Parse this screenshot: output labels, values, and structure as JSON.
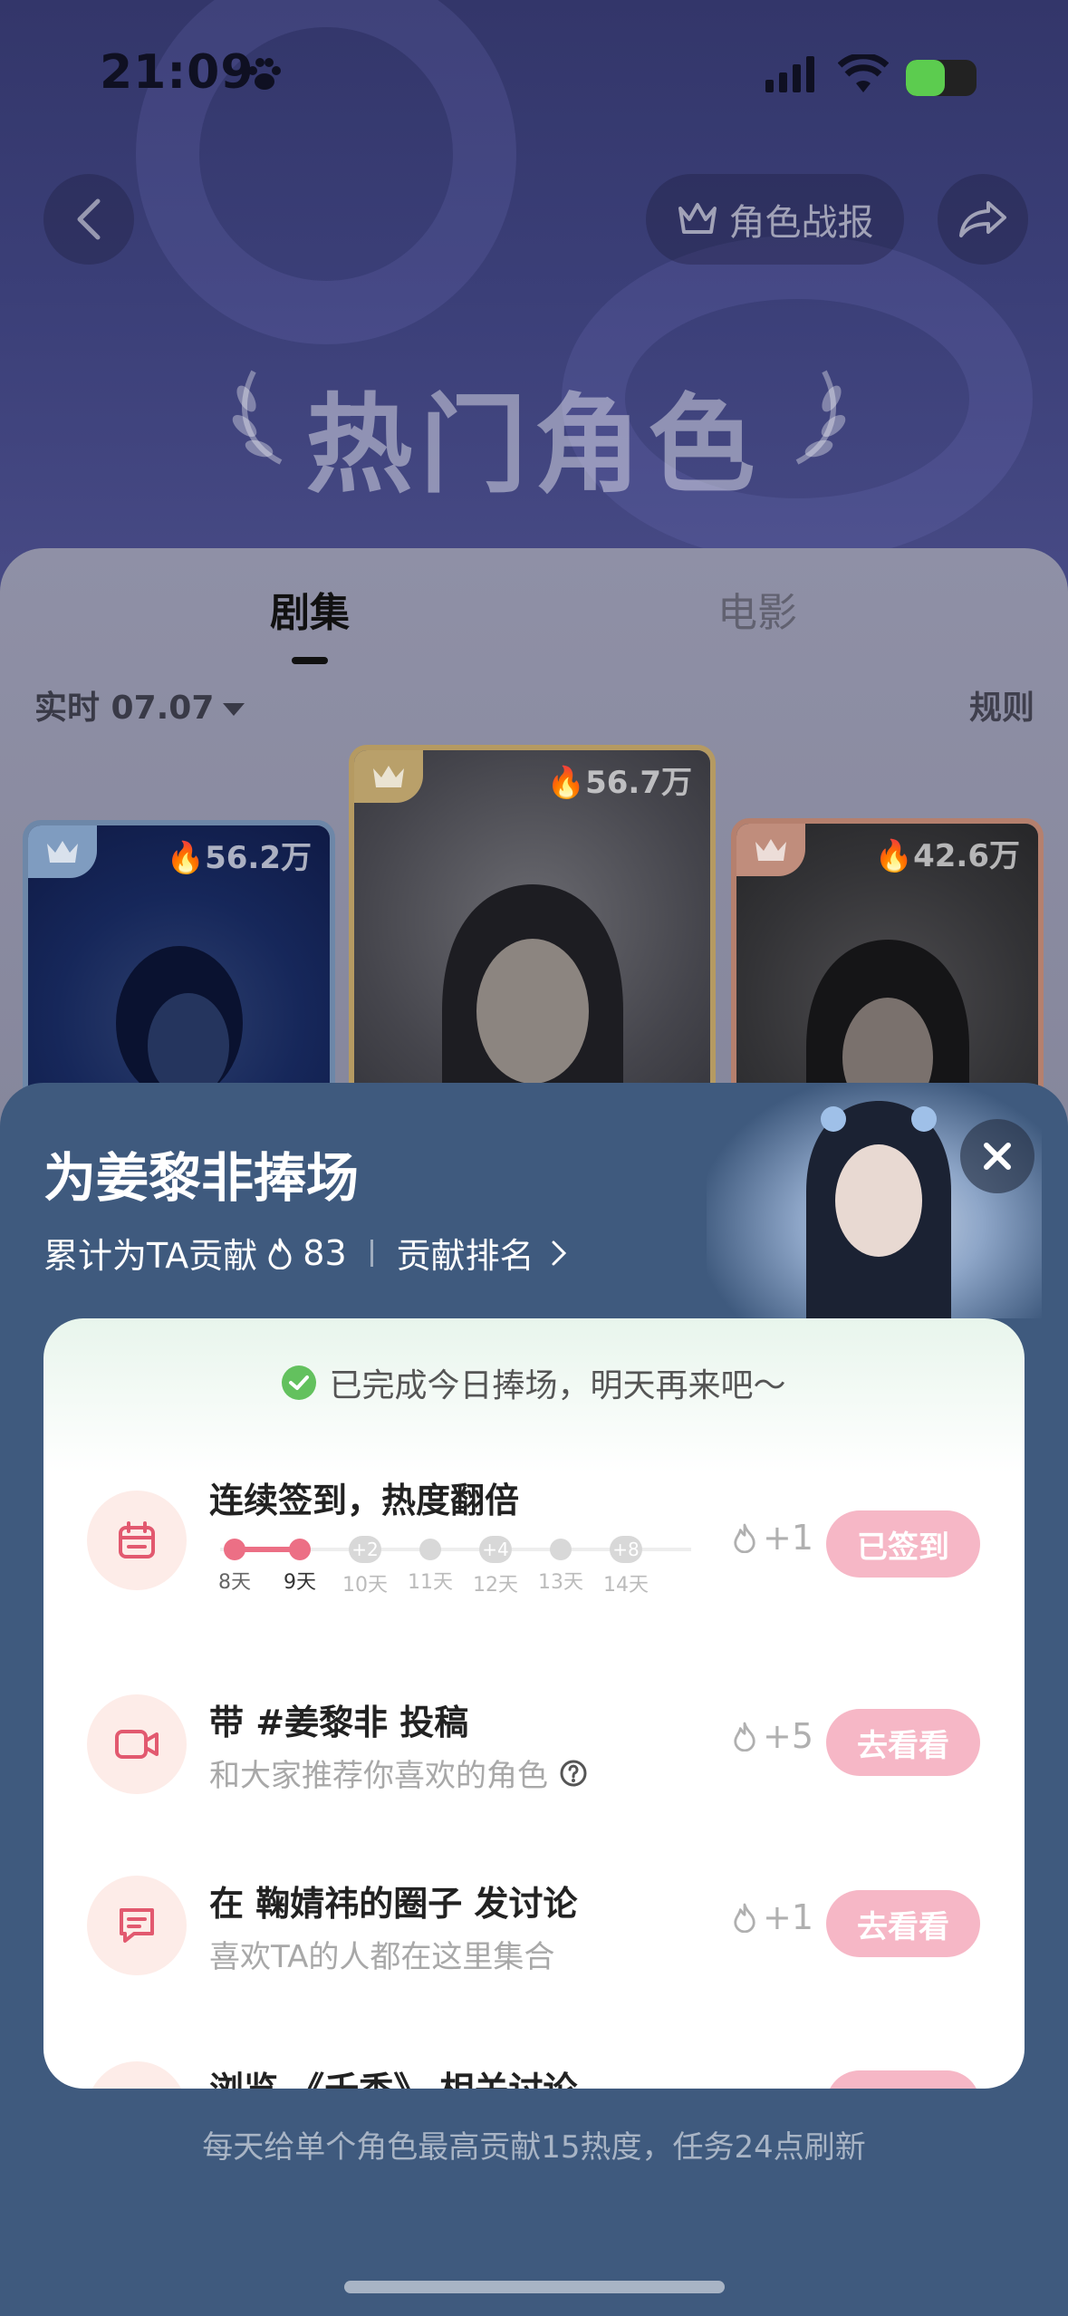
{
  "status_bar": {
    "time": "21:09"
  },
  "header": {
    "report_label": "角色战报"
  },
  "hero": {
    "title": "热门角色"
  },
  "tabs": [
    {
      "label": "剧集"
    },
    {
      "label": "电影"
    }
  ],
  "filter": {
    "label": "实时 07.07",
    "rules_label": "规则"
  },
  "cards": [
    {
      "heat": "56.2万"
    },
    {
      "heat": "56.7万"
    },
    {
      "heat": "42.6万"
    }
  ],
  "sheet": {
    "title": "为姜黎非捧场",
    "contribution_prefix": "累计为TA贡献",
    "contribution_value": "83",
    "ranking_label": "贡献排名",
    "done_tip": "已完成今日捧场，明天再来吧～",
    "tasks": [
      {
        "title": "连续签到，热度翻倍",
        "reward": "+1",
        "button": "已签到",
        "days": [
          {
            "label": "8天"
          },
          {
            "label": "9天"
          },
          {
            "label": "10天",
            "bonus": "+2"
          },
          {
            "label": "11天"
          },
          {
            "label": "12天",
            "bonus": "+4"
          },
          {
            "label": "13天"
          },
          {
            "label": "14天",
            "bonus": "+8"
          }
        ]
      },
      {
        "title": "带 #姜黎非 投稿",
        "desc": "和大家推荐你喜欢的角色",
        "reward": "+5",
        "button": "去看看"
      },
      {
        "title": "在 鞠婧祎的圈子 发讨论",
        "desc": "喜欢TA的人都在这里集合",
        "reward": "+1",
        "button": "去看看"
      },
      {
        "title": "浏览 《千香》 相关讨论",
        "button": ""
      }
    ],
    "footer_note": "每天给单个角色最高贡献15热度，任务24点刷新"
  },
  "colors": {
    "accent_pink": "#f6b7c6",
    "progress_pink": "#ec6f85",
    "sheet_bg": "#3f5a7e",
    "check_green": "#63c15e"
  },
  "icons": [
    "paw-icon",
    "signal-icon",
    "wifi-icon",
    "battery-icon",
    "back-icon",
    "crown-icon",
    "share-icon",
    "laurel-icon",
    "flame-icon",
    "chevron-right-icon",
    "close-icon",
    "check-icon",
    "calendar-icon",
    "video-icon",
    "chat-icon",
    "help-icon"
  ]
}
